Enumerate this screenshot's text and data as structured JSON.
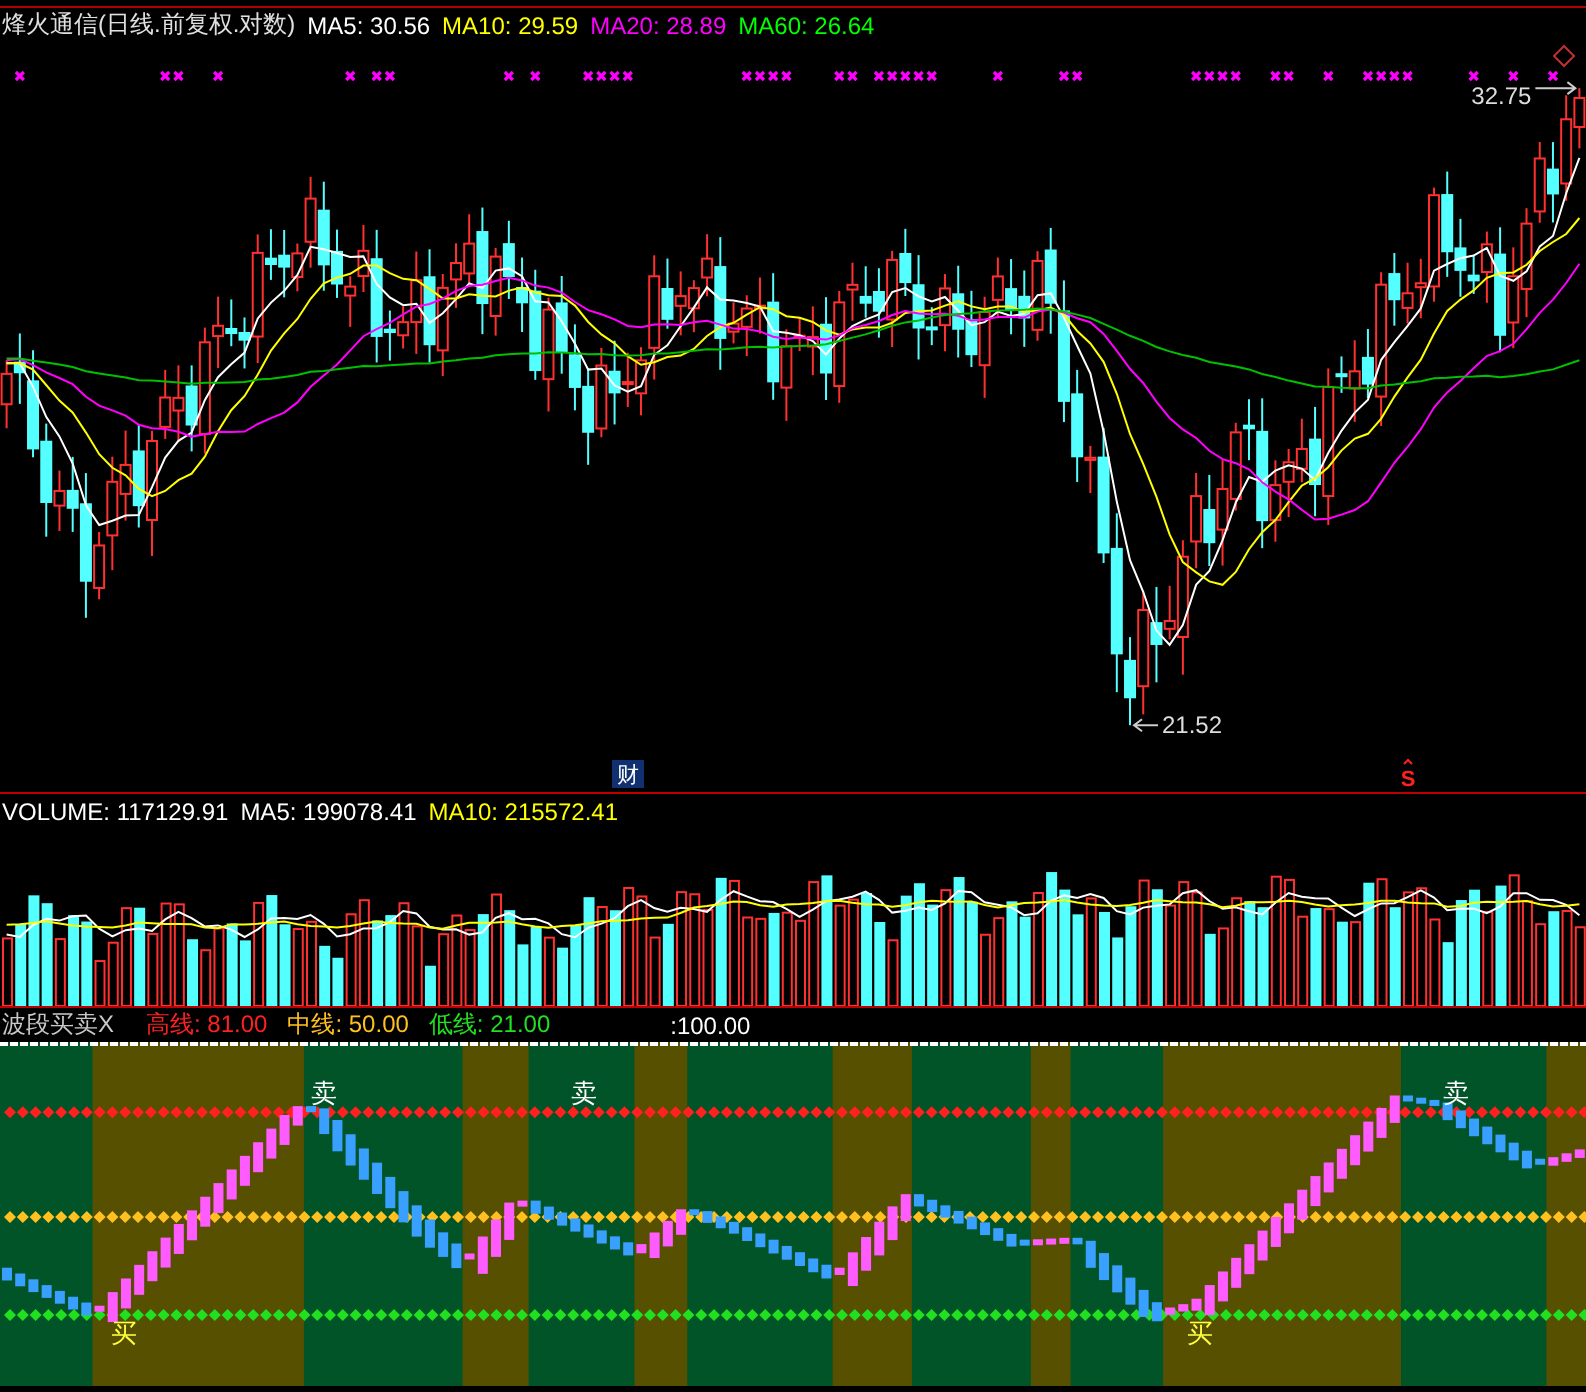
{
  "price_panel": {
    "title": "烽火通信(日线.前复权.对数)",
    "indicators": [
      {
        "label": "MA5: 30.56",
        "color": "#ffffff"
      },
      {
        "label": "MA10: 29.59",
        "color": "#ffff00"
      },
      {
        "label": "MA20: 28.89",
        "color": "#ff00ff"
      },
      {
        "label": "MA60: 26.64",
        "color": "#00ff00"
      }
    ],
    "high_label": "32.75",
    "low_label": "21.52",
    "event_markers": [
      {
        "kind": "finance",
        "label": "财"
      },
      {
        "kind": "signal",
        "label": "S"
      }
    ]
  },
  "volume_panel": {
    "indicators": [
      {
        "label": "VOLUME: 117129.91",
        "color": "#ffffff"
      },
      {
        "label": "MA5: 199078.41",
        "color": "#ffffff"
      },
      {
        "label": "MA10: 215572.41",
        "color": "#ffff00"
      }
    ]
  },
  "indicator_panel": {
    "title": "波段买卖X",
    "lines": [
      {
        "label": "高线: 81.00",
        "color": "#ff2020"
      },
      {
        "label": "中线: 50.00",
        "color": "#ffc020"
      },
      {
        "label": "低线: 21.00",
        "color": "#20e020"
      }
    ],
    "extra": ":100.00",
    "signals": [
      {
        "kind": "buy",
        "label": "买"
      },
      {
        "kind": "sell",
        "label": "卖"
      },
      {
        "kind": "sell",
        "label": "卖"
      },
      {
        "kind": "buy",
        "label": "买"
      },
      {
        "kind": "sell",
        "label": "卖"
      }
    ]
  }
}
